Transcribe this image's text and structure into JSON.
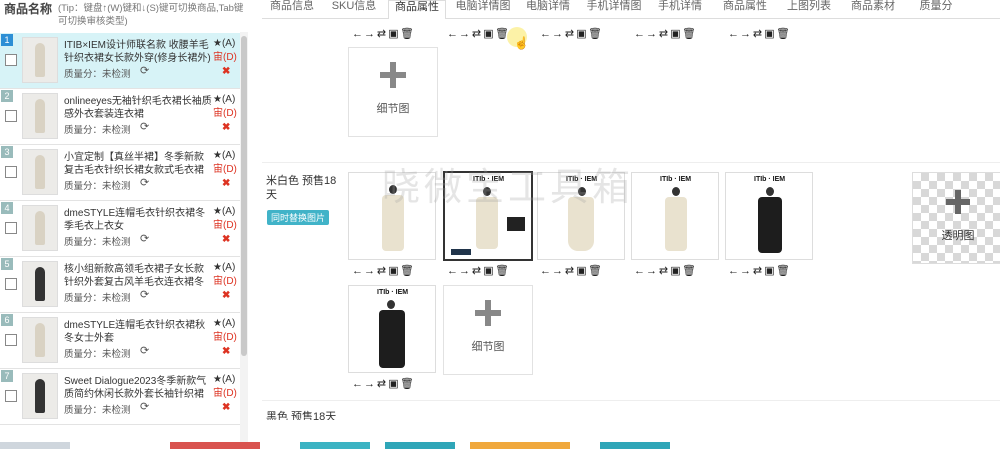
{
  "left_panel": {
    "header_title": "商品名称",
    "header_tip": "(Tip：键盘↑(W)键和↓(S)键可切换商品,Tab键可切换审核类型)",
    "products": [
      {
        "num": "1",
        "title": "ITIB×IEM设计师联名款 收腰羊毛针织衣裙女长款外穿(修身长裙外)",
        "score": "质量分：未检测",
        "star": "★(A)",
        "del": "宙(D)",
        "close": "✖"
      },
      {
        "num": "2",
        "title": "onlineeyes无袖针织毛衣裙长袖质感外衣套装连衣裙",
        "score": "质量分：未检测",
        "star": "★(A)",
        "del": "宙(D)",
        "close": "✖"
      },
      {
        "num": "3",
        "title": "小宜定制【真丝半裙】冬季新款复古毛衣针织长裙女款式毛衣裙子套装",
        "score": "质量分：未检测",
        "star": "★(A)",
        "del": "宙(D)",
        "close": "✖"
      },
      {
        "num": "4",
        "title": "dmeSTYLE连帽毛衣针织衣裙冬季毛衣上衣女",
        "score": "质量分：未检测",
        "star": "★(A)",
        "del": "宙(D)",
        "close": "✖"
      },
      {
        "num": "5",
        "title": "核小组新款高领毛衣裙子女长款针织外套复古风羊毛衣连衣裙冬季",
        "score": "质量分：未检测",
        "star": "★(A)",
        "del": "宙(D)",
        "close": "✖"
      },
      {
        "num": "6",
        "title": "dmeSTYLE连帽毛衣针织衣裙秋冬女士外套",
        "score": "质量分：未检测",
        "star": "★(A)",
        "del": "宙(D)",
        "close": "✖"
      },
      {
        "num": "7",
        "title": "Sweet Dialogue2023冬季新款气质简约休闲长款外套长袖针织裙",
        "score": "质量分：未检测",
        "star": "★(A)",
        "del": "宙(D)",
        "close": "✖"
      }
    ]
  },
  "tabs": [
    "商品信息",
    "SKU信息",
    "商品属性",
    "电脑详情图",
    "电脑详情",
    "手机详情图",
    "手机详情",
    "商品属性",
    "上图列表",
    "商品素材",
    "质量分"
  ],
  "main": {
    "detail_image_label": "细节图",
    "color_label": "米白色 预售18天",
    "color_badge": "同时替换图片",
    "transparent_label": "透明图",
    "detail_image_label_2": "细节图",
    "logo_text": "ITIb · IEM",
    "next_color_label": "黑色 预售18天"
  },
  "watermark": "晓微宝工具箱",
  "icons": [
    "arrow-left-icon",
    "arrow-right-icon",
    "repeat-icon",
    "image-icon",
    "trash-icon"
  ],
  "colors": {
    "accent": "#2d8fd5",
    "selected_row": "#d7f3f7",
    "badge": "#41b3c8",
    "danger": "#dd3322"
  }
}
